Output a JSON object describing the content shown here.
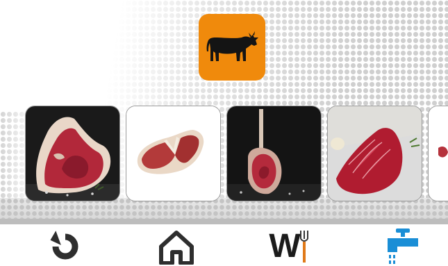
{
  "category": {
    "icon": "cow-icon",
    "color": "#f08a0c"
  },
  "carousel": {
    "items": [
      {
        "name": "prime-rib-cut",
        "background": "#1a1a1a"
      },
      {
        "name": "t-bone-cut",
        "background": "#ffffff"
      },
      {
        "name": "tomahawk-cut",
        "background": "#141414"
      },
      {
        "name": "flank-cut",
        "background": "#dcdcdc"
      },
      {
        "name": "partial-cut",
        "background": "#ffffff"
      }
    ]
  },
  "nav": {
    "back_icon": "back-arrow-icon",
    "home_icon": "home-icon",
    "wifi_logo": {
      "text": "W",
      "fork_color": "#e07a1a"
    },
    "water_icon": "water-tap-icon",
    "accent": "#1a8ed6"
  }
}
